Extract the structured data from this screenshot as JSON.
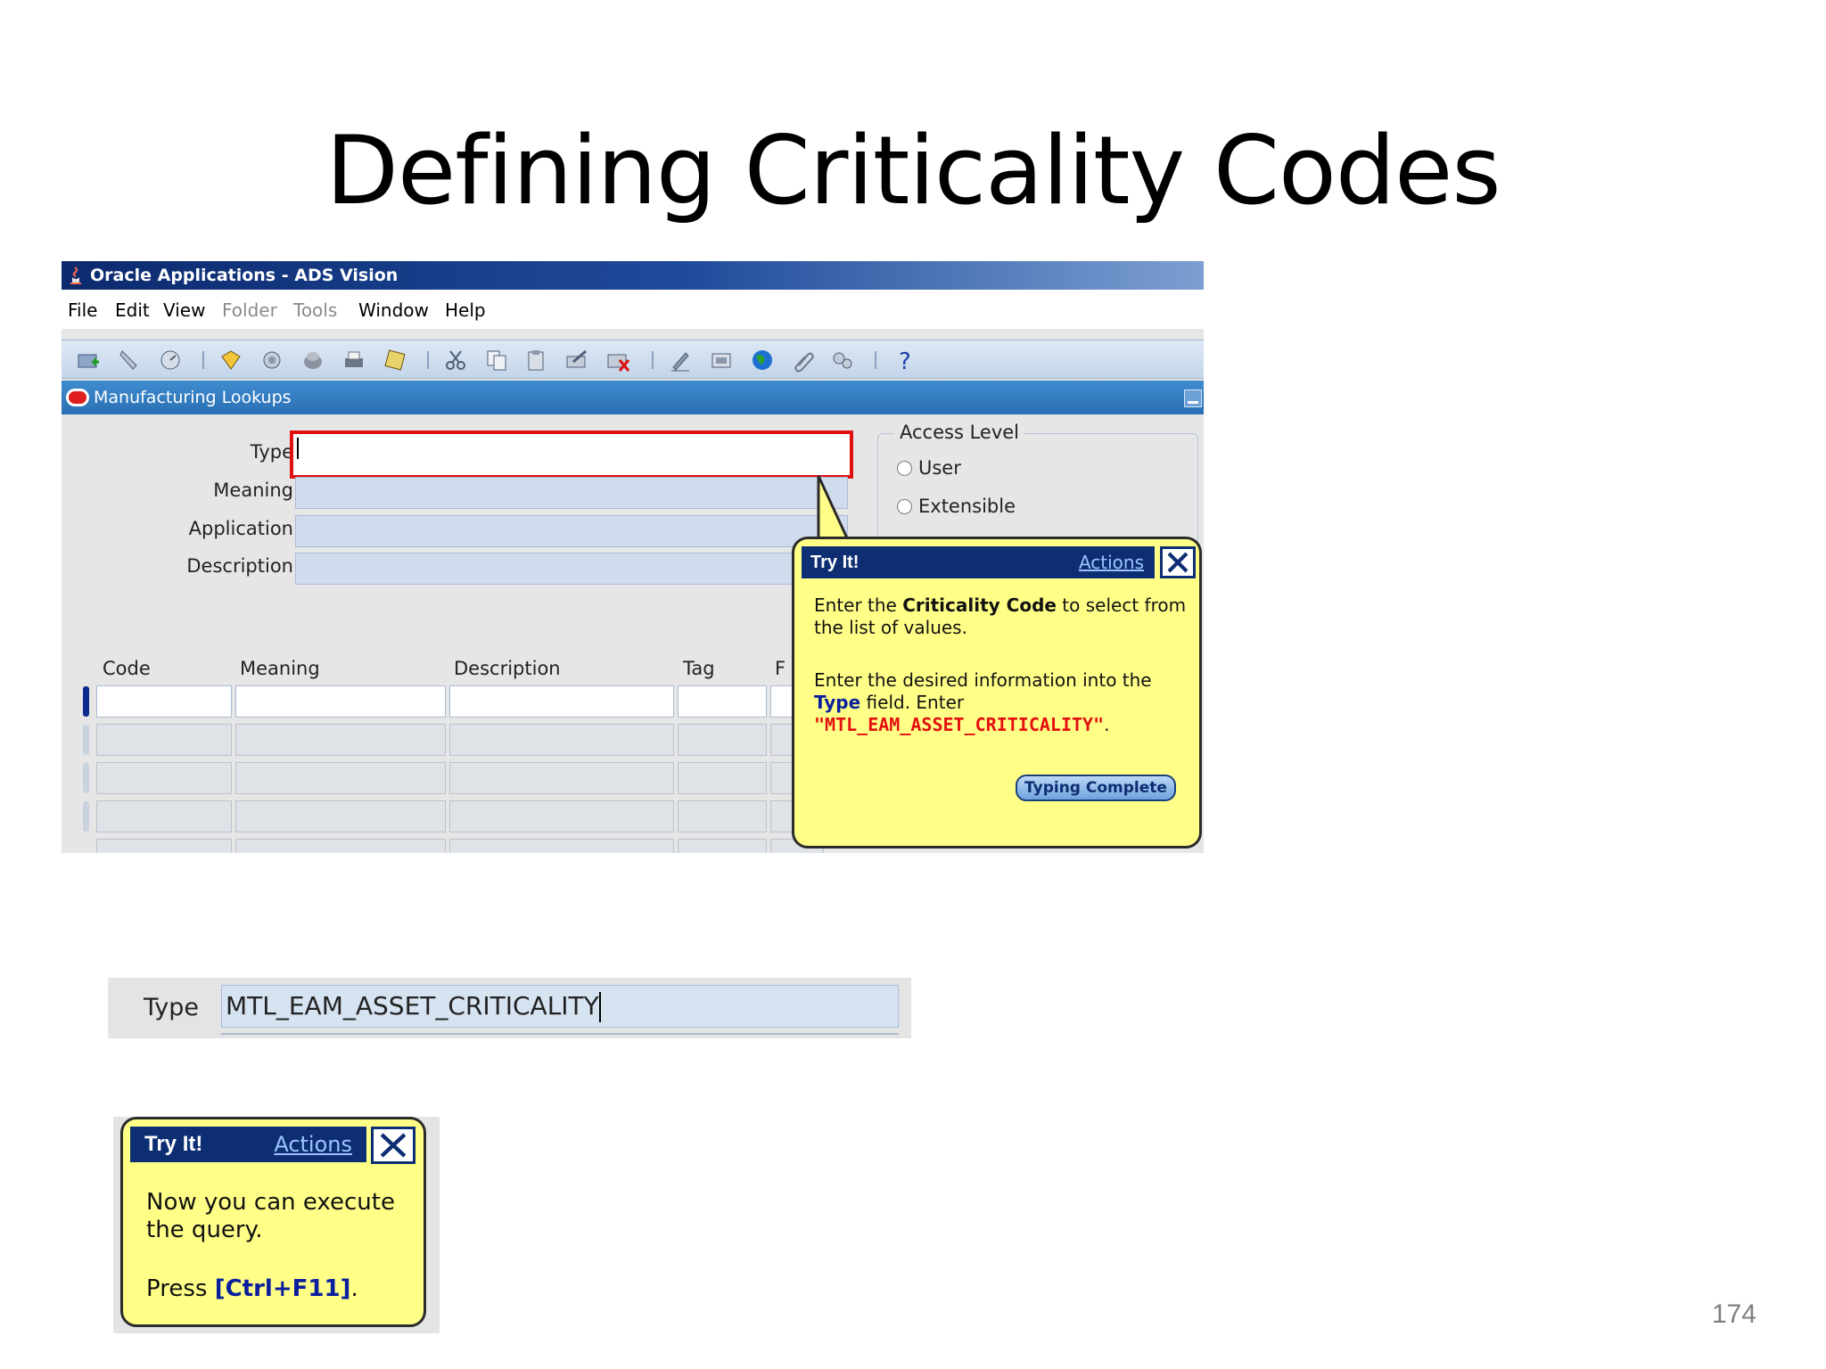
{
  "slide": {
    "title": "Defining Criticality Codes",
    "page_number": "174"
  },
  "window": {
    "title": "Oracle Applications - ADS Vision",
    "menu": [
      "File",
      "Edit",
      "View",
      "Folder",
      "Tools",
      "Window",
      "Help"
    ],
    "toolbar_icons": [
      "new-record-icon",
      "find-icon",
      "navigator-icon",
      "save-icon",
      "next-step-icon",
      "switch-responsibility-icon",
      "print-icon",
      "close-form-icon",
      "cut-icon",
      "copy-icon",
      "paste-icon",
      "clear-record-icon",
      "delete-record-icon",
      "edit-field-icon",
      "zoom-icon",
      "translations-icon",
      "attachments-icon",
      "folder-tools-icon",
      "help-icon"
    ]
  },
  "form": {
    "title": "Manufacturing Lookups",
    "fields": {
      "type_label": "Type",
      "meaning_label": "Meaning",
      "application_label": "Application",
      "description_label": "Description"
    },
    "access_level": {
      "legend": "Access Level",
      "options": [
        "User",
        "Extensible"
      ]
    },
    "grid": {
      "columns": [
        "Code",
        "Meaning",
        "Description",
        "Tag",
        "F"
      ]
    }
  },
  "tryit": {
    "title": "Try It!",
    "actions_label": "Actions",
    "p1_prefix": "Enter the ",
    "p1_bold": "Criticality Code",
    "p1_suffix": " to select from the list of values.",
    "p2_prefix": "Enter the desired information into the ",
    "p2_bold": "Type",
    "p2_middle": " field. Enter ",
    "p2_code": "\"MTL_EAM_ASSET_CRITICALITY\"",
    "p2_suffix": ".",
    "button_label": "Typing Complete"
  },
  "type_snippet": {
    "label": "Type",
    "value": "MTL_EAM_ASSET_CRITICALITY"
  },
  "small_tryit": {
    "title": "Try It!",
    "actions_label": "Actions",
    "line1": "Now you can execute the query.",
    "press_prefix": "Press ",
    "press_keys": "[Ctrl+F11]",
    "press_suffix": "."
  }
}
